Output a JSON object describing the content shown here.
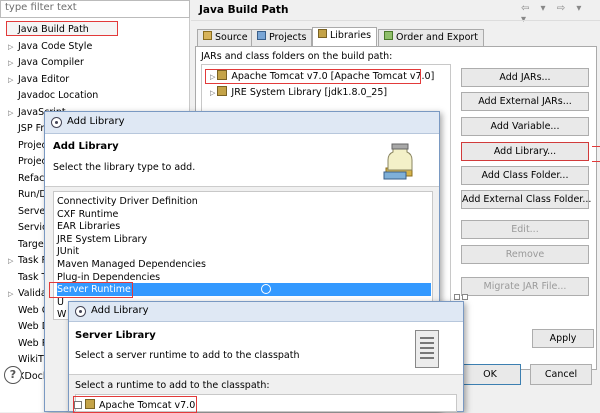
{
  "left_panel": {
    "filter_placeholder": "type filter text",
    "tree": [
      {
        "label": "Java Build Path",
        "twisty": ""
      },
      {
        "label": "Java Code Style",
        "twisty": "▷"
      },
      {
        "label": "Java Compiler",
        "twisty": "▷"
      },
      {
        "label": "Java Editor",
        "twisty": "▷"
      },
      {
        "label": "Javadoc Location",
        "twisty": ""
      },
      {
        "label": "JavaScript",
        "twisty": "▷"
      },
      {
        "label": "JSP Fr",
        "twisty": ""
      },
      {
        "label": "Projec",
        "twisty": ""
      },
      {
        "label": "Projec",
        "twisty": ""
      },
      {
        "label": "Refact",
        "twisty": ""
      },
      {
        "label": "Run/D",
        "twisty": ""
      },
      {
        "label": "Server",
        "twisty": ""
      },
      {
        "label": "Servic",
        "twisty": ""
      },
      {
        "label": "Targe",
        "twisty": ""
      },
      {
        "label": "Task R",
        "twisty": "▷"
      },
      {
        "label": "Task T",
        "twisty": ""
      },
      {
        "label": "Valida",
        "twisty": "▷"
      },
      {
        "label": "Web C",
        "twisty": ""
      },
      {
        "label": "Web D",
        "twisty": ""
      },
      {
        "label": "Web P",
        "twisty": ""
      },
      {
        "label": "WikiT",
        "twisty": ""
      },
      {
        "label": "XDocl",
        "twisty": "▷"
      }
    ],
    "help_label": "?"
  },
  "right_panel": {
    "title": "Java Build Path",
    "nav_glyphs": "⇦ ▾ ⇨ ▾ ▾",
    "tabs": [
      {
        "label": "Source",
        "icon": "source-icon"
      },
      {
        "label": "Projects",
        "icon": "projects-icon"
      },
      {
        "label": "Libraries",
        "icon": "libraries-icon"
      },
      {
        "label": "Order and Export",
        "icon": "order-icon"
      }
    ],
    "jars_label": "JARs and class folders on the build path:",
    "jars": [
      {
        "label": "Apache Tomcat v7.0 [Apache Tomcat v7.0]"
      },
      {
        "label": "JRE System Library [jdk1.8.0_25]"
      }
    ],
    "buttons": [
      {
        "label": "Add JARs...",
        "enabled": true
      },
      {
        "label": "Add External JARs...",
        "enabled": true
      },
      {
        "label": "Add Variable...",
        "enabled": true
      },
      {
        "label": "Add Library...",
        "enabled": true
      },
      {
        "label": "Add Class Folder...",
        "enabled": true
      },
      {
        "label": "Add External Class Folder...",
        "enabled": true
      },
      {
        "label": "Edit...",
        "enabled": false
      },
      {
        "label": "Remove",
        "enabled": false
      },
      {
        "label": "Migrate JAR File...",
        "enabled": false
      }
    ],
    "apply_label": "Apply",
    "ok_label": "OK",
    "cancel_label": "Cancel"
  },
  "add_library_dialog": {
    "title": "Add Library",
    "heading": "Add Library",
    "description": "Select the library type to add.",
    "items": [
      "Connectivity Driver Definition",
      "CXF Runtime",
      "EAR Libraries",
      "JRE System Library",
      "JUnit",
      "Maven Managed Dependencies",
      "Plug-in Dependencies",
      "Server Runtime",
      "U",
      "W"
    ],
    "selected_index": 7
  },
  "server_library_dialog": {
    "title": "Add Library",
    "heading": "Server Library",
    "description": "Select a server runtime to add to the classpath",
    "runtime_label": "Select a runtime to add to the classpath:",
    "runtime_item": "Apache Tomcat v7.0"
  },
  "colors": {
    "highlight_red": "#e23a3a",
    "selection_blue": "#3399ff"
  }
}
